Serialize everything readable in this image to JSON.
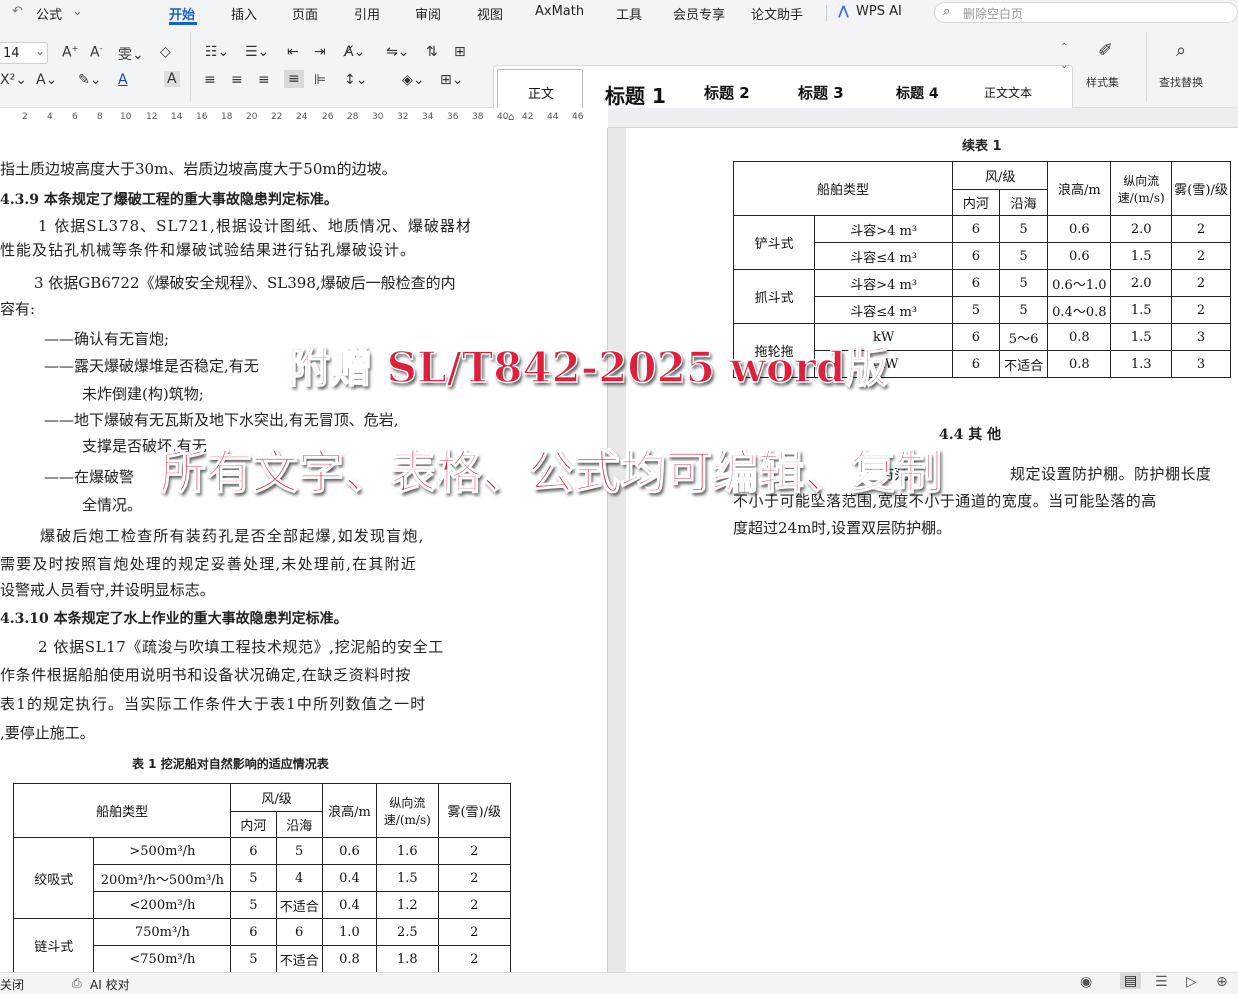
{
  "menubar": {
    "formula_tab": "公式",
    "tabs": [
      "开始",
      "插入",
      "页面",
      "引用",
      "审阅",
      "视图",
      "AxMath",
      "工具",
      "会员专享",
      "论文助手"
    ],
    "wps_ai": "WPS AI",
    "search_placeholder": "删除空白页"
  },
  "ribbon": {
    "font_size": "14",
    "styles": [
      "正文",
      "标题 1",
      "标题 2",
      "标题 3",
      "标题 4",
      "正文文本"
    ],
    "style_set_label": "样式集",
    "find_replace_label": "查找替换"
  },
  "ruler": {
    "ticks": [
      "2",
      "4",
      "6",
      "8",
      "10",
      "12",
      "14",
      "16",
      "18",
      "20",
      "22",
      "24",
      "26",
      "28",
      "30",
      "32",
      "34",
      "36",
      "38",
      "40",
      "42",
      "44",
      "46"
    ]
  },
  "left_page": {
    "lines": [
      "指土质边坡高度大于30m、岩质边坡高度大于50m的边坡。",
      "4.3.9  本条规定了爆破工程的重大事故隐患判定标准。",
      "1 依据SL378、SL721,根据设计图纸、地质情况、爆破器材",
      "性能及钻孔机械等条件和爆破试验结果进行钻孔爆破设计。",
      "3 依据GB6722《爆破安全规程》、SL398,爆破后一般检查的内",
      "容有:",
      "——确认有无盲炮;",
      "——露天爆破爆堆是否稳定,有无",
      "未炸倒建(构)筑物;",
      "——地下爆破有无瓦斯及地下水突出,有无冒顶、危岩,",
      "支撑是否破坏,有无",
      "——在爆破警",
      "全情况。",
      "爆破后炮工检查所有装药孔是否全部起爆,如发现盲炮,",
      "需要及时按照盲炮处理的规定妥善处理,未处理前,在其附近",
      "设警戒人员看守,并设明显标志。",
      "4.3.10  本条规定了水上作业的重大事故隐患判定标准。",
      "2 依据SL17《疏浚与吹填工程技术规范》,挖泥船的安全工",
      "作条件根据船舶使用说明书和设备状况确定,在缺乏资料时按",
      "表1的规定执行。当实际工作条件大于表1中所列数值之一时",
      ",要停止施工。"
    ],
    "table_caption": "表 1 挖泥船对自然影响的适应情况表",
    "table": {
      "h_ship": "船舶类型",
      "h_wind": "风/级",
      "h_inland": "内河",
      "h_coastal": "沿海",
      "h_wave": "浪高/m",
      "h_flow": "纵向流速/(m/s)",
      "h_fog": "雾(雪)/级",
      "groups": [
        {
          "name": "绞吸式",
          "rows": [
            [
              "&gt;500m³/h",
              "6",
              "5",
              "0.6",
              "1.6",
              "2"
            ],
            [
              "200m³/h～500m³/h",
              "5",
              "4",
              "0.4",
              "1.5",
              "2"
            ],
            [
              "&lt;200m³/h",
              "5",
              "不适合",
              "0.4",
              "1.2",
              "2"
            ]
          ]
        },
        {
          "name": "链斗式",
          "rows": [
            [
              "750m³/h",
              "6",
              "6",
              "1.0",
              "2.5",
              "2"
            ],
            [
              "&lt;750m³/h",
              "5",
              "不适合",
              "0.8",
              "1.8",
              "2"
            ]
          ]
        }
      ]
    }
  },
  "right_page": {
    "cont_caption": "续表 1",
    "table": {
      "h_ship": "船舶类型",
      "h_wind": "风/级",
      "h_inland": "内河",
      "h_coastal": "沿海",
      "h_wave": "浪高/m",
      "h_flow": "纵向流速/(m/s)",
      "h_fog": "雾(雪)/级",
      "groups": [
        {
          "name": "铲斗式",
          "rows": [
            [
              "斗容&gt;4 m³",
              "6",
              "5",
              "0.6",
              "2.0",
              "2"
            ],
            [
              "斗容≤4 m³",
              "6",
              "5",
              "0.6",
              "1.5",
              "2"
            ]
          ]
        },
        {
          "name": "抓斗式",
          "rows": [
            [
              "斗容&gt;4 m³",
              "6",
              "5",
              "0.6～1.0",
              "2.0",
              "2"
            ],
            [
              "斗容≤4 m³",
              "5",
              "5",
              "0.4～0.8",
              "1.5",
              "2"
            ]
          ]
        },
        {
          "name": "拖轮拖",
          "rows": [
            [
              "kW",
              "6",
              "5～6",
              "0.8",
              "1.5",
              "3"
            ],
            [
              "4kW",
              "6",
              "不适合",
              "0.8",
              "1.3",
              "3"
            ]
          ]
        }
      ]
    },
    "section_title": "4.4 其    他",
    "lines": [
      "为防范",
      "规定设置防护棚。防护棚长度",
      "不小于可能坠落范围,宽度不小于通道的宽度。当可能坠落的高",
      "度超过24m时,设置双层防护棚。"
    ]
  },
  "overlay": {
    "line1": "附赠 SL/T842-2025 word版",
    "line2": "所有文字、表格、公式均可编辑、复制"
  },
  "statusbar": {
    "left1": "关闭",
    "ai_check": "AI 校对"
  },
  "colors": {
    "accent": "#1a5fd0",
    "overlay_red": "#e01f3d",
    "ribbon_bg": "#f3f4f6"
  }
}
